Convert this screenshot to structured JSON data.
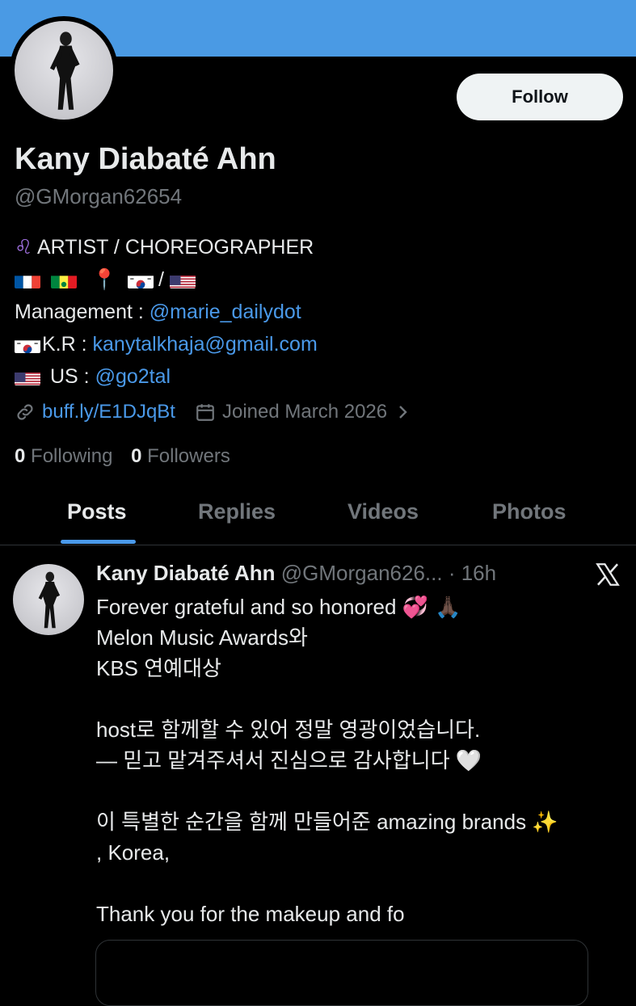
{
  "profile": {
    "follow_label": "Follow",
    "name": "Kany Diabaté Ahn",
    "handle": "@GMorgan62654",
    "bio": {
      "line1_emoji": "♌",
      "line1_text": "ARTIST / CHOREOGRAPHER",
      "pin": "📍",
      "slash": "/",
      "mgmt_label": "Management : ",
      "mgmt_link": "@marie_dailydot",
      "kr_label": "K.R : ",
      "kr_link": "kanytalkhaja@gmail.com",
      "us_label": "US : ",
      "us_link": "@go2tal"
    },
    "website": "buff.ly/E1DJqBt",
    "joined": "Joined March 2026",
    "following_count": "0",
    "following_label": "Following",
    "followers_count": "0",
    "followers_label": "Followers"
  },
  "tabs": [
    "Posts",
    "Replies",
    "Videos",
    "Photos"
  ],
  "post": {
    "name": "Kany Diabaté Ahn",
    "handle": "@GMorgan626...",
    "time": "· 16h",
    "line1": "Forever grateful and so honored",
    "line1_emoji": "💞 🙏🏿",
    "line2": "Melon Music Awards와",
    "line3": "KBS 연예대상",
    "line4": "host로 함께할 수 있어 정말 영광이었습니다.",
    "line5": "— 믿고 맡겨주셔서 진심으로 감사합니다",
    "line5_emoji": "🤍",
    "line6": "이 특별한 순간을 함께 만들어준 amazing brands",
    "line6_emoji": "✨",
    "line7": ",  Korea,",
    "line8": "Thank you  for the makeup and  fo"
  },
  "colors": {
    "banner": "#4a9ae4",
    "link": "#4a99e9",
    "secondary_text": "#71767b",
    "background": "#000000"
  },
  "icons": [
    "link-icon",
    "calendar-icon",
    "chevron-right-icon",
    "x-logo-icon"
  ]
}
